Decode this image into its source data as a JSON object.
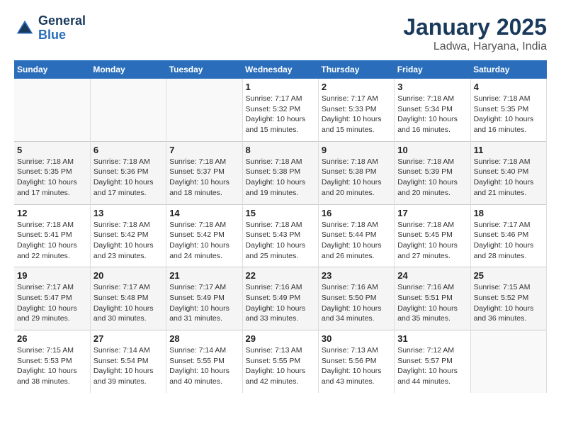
{
  "header": {
    "logo_line1": "General",
    "logo_line2": "Blue",
    "month": "January 2025",
    "location": "Ladwa, Haryana, India"
  },
  "weekdays": [
    "Sunday",
    "Monday",
    "Tuesday",
    "Wednesday",
    "Thursday",
    "Friday",
    "Saturday"
  ],
  "weeks": [
    [
      {
        "day": "",
        "info": ""
      },
      {
        "day": "",
        "info": ""
      },
      {
        "day": "",
        "info": ""
      },
      {
        "day": "1",
        "info": "Sunrise: 7:17 AM\nSunset: 5:32 PM\nDaylight: 10 hours\nand 15 minutes."
      },
      {
        "day": "2",
        "info": "Sunrise: 7:17 AM\nSunset: 5:33 PM\nDaylight: 10 hours\nand 15 minutes."
      },
      {
        "day": "3",
        "info": "Sunrise: 7:18 AM\nSunset: 5:34 PM\nDaylight: 10 hours\nand 16 minutes."
      },
      {
        "day": "4",
        "info": "Sunrise: 7:18 AM\nSunset: 5:35 PM\nDaylight: 10 hours\nand 16 minutes."
      }
    ],
    [
      {
        "day": "5",
        "info": "Sunrise: 7:18 AM\nSunset: 5:35 PM\nDaylight: 10 hours\nand 17 minutes."
      },
      {
        "day": "6",
        "info": "Sunrise: 7:18 AM\nSunset: 5:36 PM\nDaylight: 10 hours\nand 17 minutes."
      },
      {
        "day": "7",
        "info": "Sunrise: 7:18 AM\nSunset: 5:37 PM\nDaylight: 10 hours\nand 18 minutes."
      },
      {
        "day": "8",
        "info": "Sunrise: 7:18 AM\nSunset: 5:38 PM\nDaylight: 10 hours\nand 19 minutes."
      },
      {
        "day": "9",
        "info": "Sunrise: 7:18 AM\nSunset: 5:38 PM\nDaylight: 10 hours\nand 20 minutes."
      },
      {
        "day": "10",
        "info": "Sunrise: 7:18 AM\nSunset: 5:39 PM\nDaylight: 10 hours\nand 20 minutes."
      },
      {
        "day": "11",
        "info": "Sunrise: 7:18 AM\nSunset: 5:40 PM\nDaylight: 10 hours\nand 21 minutes."
      }
    ],
    [
      {
        "day": "12",
        "info": "Sunrise: 7:18 AM\nSunset: 5:41 PM\nDaylight: 10 hours\nand 22 minutes."
      },
      {
        "day": "13",
        "info": "Sunrise: 7:18 AM\nSunset: 5:42 PM\nDaylight: 10 hours\nand 23 minutes."
      },
      {
        "day": "14",
        "info": "Sunrise: 7:18 AM\nSunset: 5:42 PM\nDaylight: 10 hours\nand 24 minutes."
      },
      {
        "day": "15",
        "info": "Sunrise: 7:18 AM\nSunset: 5:43 PM\nDaylight: 10 hours\nand 25 minutes."
      },
      {
        "day": "16",
        "info": "Sunrise: 7:18 AM\nSunset: 5:44 PM\nDaylight: 10 hours\nand 26 minutes."
      },
      {
        "day": "17",
        "info": "Sunrise: 7:18 AM\nSunset: 5:45 PM\nDaylight: 10 hours\nand 27 minutes."
      },
      {
        "day": "18",
        "info": "Sunrise: 7:17 AM\nSunset: 5:46 PM\nDaylight: 10 hours\nand 28 minutes."
      }
    ],
    [
      {
        "day": "19",
        "info": "Sunrise: 7:17 AM\nSunset: 5:47 PM\nDaylight: 10 hours\nand 29 minutes."
      },
      {
        "day": "20",
        "info": "Sunrise: 7:17 AM\nSunset: 5:48 PM\nDaylight: 10 hours\nand 30 minutes."
      },
      {
        "day": "21",
        "info": "Sunrise: 7:17 AM\nSunset: 5:49 PM\nDaylight: 10 hours\nand 31 minutes."
      },
      {
        "day": "22",
        "info": "Sunrise: 7:16 AM\nSunset: 5:49 PM\nDaylight: 10 hours\nand 33 minutes."
      },
      {
        "day": "23",
        "info": "Sunrise: 7:16 AM\nSunset: 5:50 PM\nDaylight: 10 hours\nand 34 minutes."
      },
      {
        "day": "24",
        "info": "Sunrise: 7:16 AM\nSunset: 5:51 PM\nDaylight: 10 hours\nand 35 minutes."
      },
      {
        "day": "25",
        "info": "Sunrise: 7:15 AM\nSunset: 5:52 PM\nDaylight: 10 hours\nand 36 minutes."
      }
    ],
    [
      {
        "day": "26",
        "info": "Sunrise: 7:15 AM\nSunset: 5:53 PM\nDaylight: 10 hours\nand 38 minutes."
      },
      {
        "day": "27",
        "info": "Sunrise: 7:14 AM\nSunset: 5:54 PM\nDaylight: 10 hours\nand 39 minutes."
      },
      {
        "day": "28",
        "info": "Sunrise: 7:14 AM\nSunset: 5:55 PM\nDaylight: 10 hours\nand 40 minutes."
      },
      {
        "day": "29",
        "info": "Sunrise: 7:13 AM\nSunset: 5:55 PM\nDaylight: 10 hours\nand 42 minutes."
      },
      {
        "day": "30",
        "info": "Sunrise: 7:13 AM\nSunset: 5:56 PM\nDaylight: 10 hours\nand 43 minutes."
      },
      {
        "day": "31",
        "info": "Sunrise: 7:12 AM\nSunset: 5:57 PM\nDaylight: 10 hours\nand 44 minutes."
      },
      {
        "day": "",
        "info": ""
      }
    ]
  ]
}
